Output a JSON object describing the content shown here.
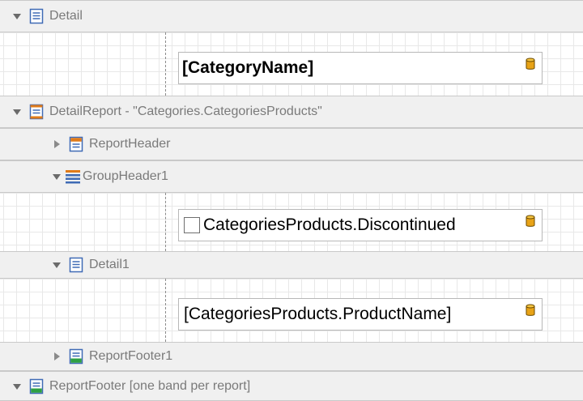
{
  "bands": {
    "detail": {
      "label": "Detail",
      "icon": "detail-band-icon",
      "expanded": true
    },
    "detail_report": {
      "label": "DetailReport - \"Categories.CategoriesProducts\"",
      "icon": "detail-report-icon",
      "expanded": true
    },
    "report_header": {
      "label": "ReportHeader",
      "icon": "report-header-icon",
      "expanded": false
    },
    "group_header": {
      "label": "GroupHeader1",
      "icon": "group-header-icon",
      "expanded": true
    },
    "detail1": {
      "label": "Detail1",
      "icon": "detail-band-icon",
      "expanded": true
    },
    "report_footer1": {
      "label": "ReportFooter1",
      "icon": "report-footer-icon",
      "expanded": false
    },
    "report_footer": {
      "label": "ReportFooter [one band per report]",
      "icon": "report-footer-icon",
      "expanded": true
    }
  },
  "fields": {
    "category_name": "[CategoryName]",
    "discontinued": "CategoriesProducts.Discontinued",
    "product_name": "[CategoriesProducts.ProductName]"
  },
  "colors": {
    "band_header_bg": "#f0f0f0",
    "icon_blue": "#3f6bb5",
    "icon_orange": "#e07b1a",
    "icon_green": "#2ea043",
    "db_icon_gold": "#e8a317"
  }
}
